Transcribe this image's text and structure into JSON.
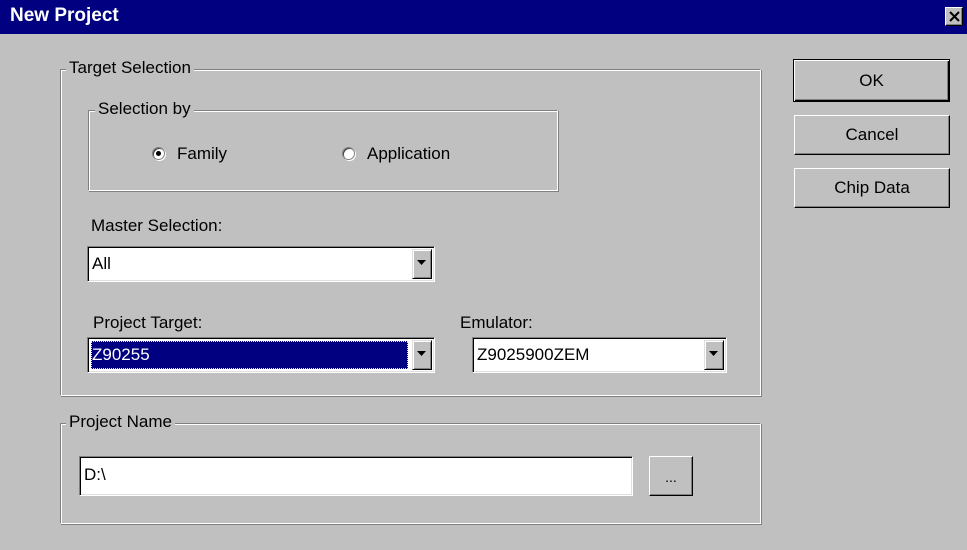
{
  "window": {
    "title": "New Project",
    "close_glyph": "close-icon"
  },
  "target_selection": {
    "legend": "Target Selection",
    "selection_by": {
      "legend": "Selection by",
      "options": [
        {
          "label": "Family",
          "selected": true
        },
        {
          "label": "Application",
          "selected": false
        }
      ]
    },
    "master_selection": {
      "label": "Master Selection:",
      "value": "All"
    },
    "project_target": {
      "label": "Project Target:",
      "value": "Z90255"
    },
    "emulator": {
      "label": "Emulator:",
      "value": "Z9025900ZEM"
    }
  },
  "project_name": {
    "legend": "Project Name",
    "value": "D:\\",
    "browse_label": "..."
  },
  "buttons": {
    "ok": "OK",
    "cancel": "Cancel",
    "chip_data": "Chip Data"
  },
  "colors": {
    "titlebar": "#000080",
    "face": "#c0c0c0",
    "selection": "#000080"
  }
}
